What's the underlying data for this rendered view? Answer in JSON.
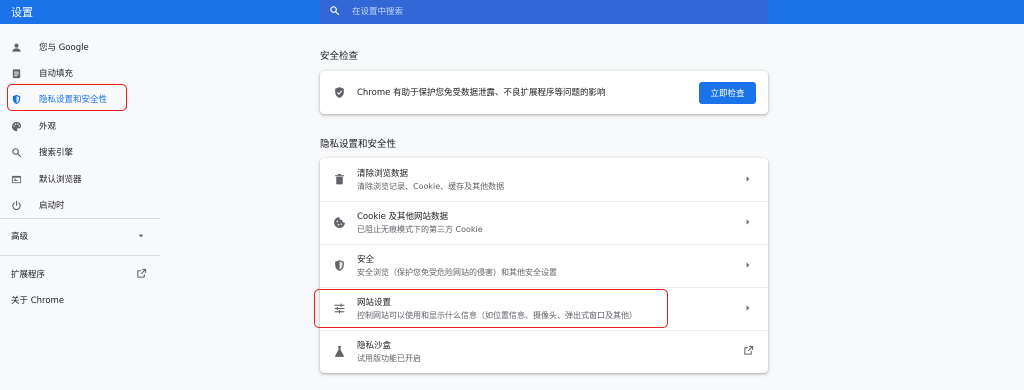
{
  "header": {
    "title": "设置"
  },
  "search": {
    "placeholder": "在设置中搜索"
  },
  "sidebar": {
    "items": [
      {
        "label": "您与 Google"
      },
      {
        "label": "自动填充"
      },
      {
        "label": "隐私设置和安全性"
      },
      {
        "label": "外观"
      },
      {
        "label": "搜索引擎"
      },
      {
        "label": "默认浏览器"
      },
      {
        "label": "启动时"
      }
    ],
    "advanced": "高级",
    "extensions": "扩展程序",
    "about": "关于 Chrome"
  },
  "safety": {
    "title": "安全检查",
    "text": "Chrome 有助于保护您免受数据泄露、不良扩展程序等问题的影响",
    "button": "立即检查"
  },
  "privacy": {
    "title": "隐私设置和安全性",
    "rows": [
      {
        "title": "清除浏览数据",
        "subtitle": "清除浏览记录、Cookie、缓存及其他数据"
      },
      {
        "title": "Cookie 及其他网站数据",
        "subtitle": "已阻止无痕模式下的第三方 Cookie"
      },
      {
        "title": "安全",
        "subtitle": "安全浏览（保护您免受危险网站的侵害）和其他安全设置"
      },
      {
        "title": "网站设置",
        "subtitle": "控制网站可以使用和显示什么信息（如位置信息、摄像头、弹出式窗口及其他）"
      },
      {
        "title": "隐私沙盒",
        "subtitle": "试用版功能已开启"
      }
    ]
  },
  "colors": {
    "accent": "#1a73e8",
    "annotation": "#e8201d"
  }
}
